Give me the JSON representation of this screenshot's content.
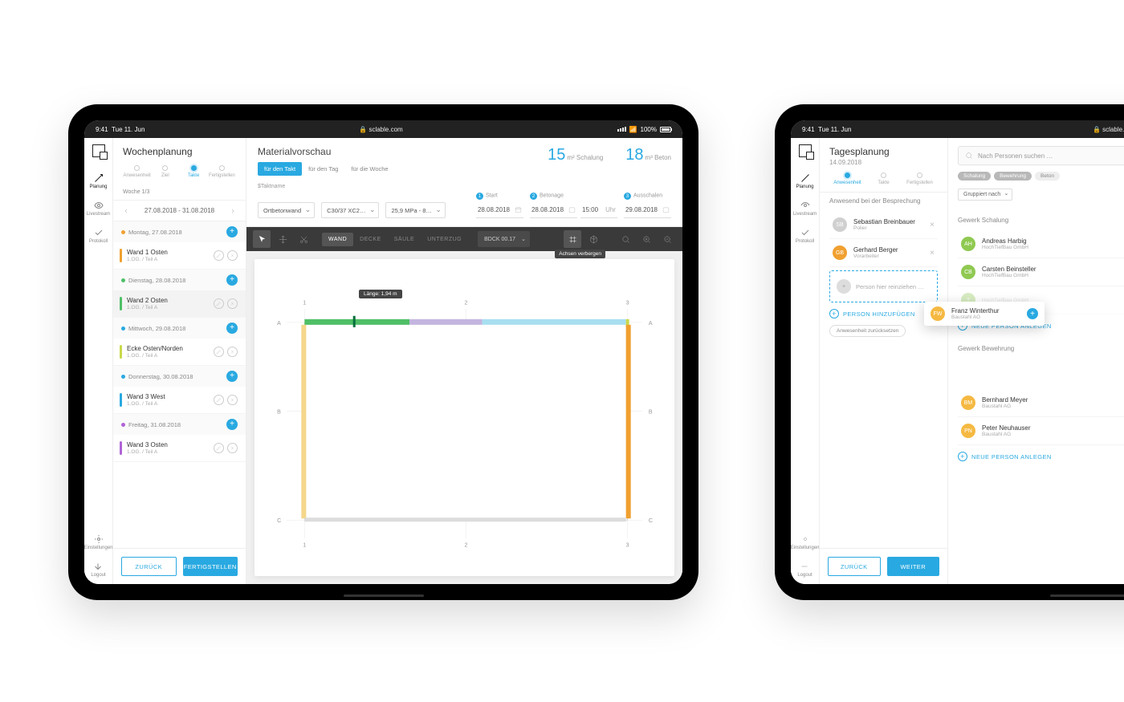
{
  "status": {
    "time": "9:41",
    "day": "Tue 11. Jun",
    "url": "sclable.com",
    "battery": "100%"
  },
  "nav": {
    "items": [
      {
        "id": "planung",
        "label": "Planung"
      },
      {
        "id": "livestream",
        "label": "Livestream"
      },
      {
        "id": "protokoll",
        "label": "Protokoll"
      }
    ],
    "settings": "Einstellungen",
    "logout": "Logout"
  },
  "t1": {
    "sidebar": {
      "title": "Wochenplanung",
      "steps": [
        {
          "label": "Anwesenheit"
        },
        {
          "label": "Ziel"
        },
        {
          "label": "Takte",
          "active": true
        },
        {
          "label": "Fertigstellen"
        }
      ],
      "week": "Woche 1/3",
      "range": "27.08.2018 - 31.08.2018",
      "days": [
        {
          "label": "Montag, 27.08.2018",
          "dot": "#f0a030",
          "tasks": [
            {
              "title": "Wand 1 Osten",
              "sub": "1.OG. / Teil A",
              "bar": "#f0a030"
            }
          ]
        },
        {
          "label": "Dienstag, 28.08.2018",
          "dot": "#4fbf67",
          "tasks": [
            {
              "title": "Wand 2 Osten",
              "sub": "1.OG. / Teil A",
              "bar": "#4fbf67",
              "sel": true
            }
          ]
        },
        {
          "label": "Mittwoch, 29.08.2018",
          "dot": "#29a9e1",
          "tasks": [
            {
              "title": "Ecke Osten/Norden",
              "sub": "1.OG. / Teil A",
              "bar": "#c9d94a"
            }
          ]
        },
        {
          "label": "Donnerstag, 30.08.2018",
          "dot": "#29a9e1",
          "tasks": [
            {
              "title": "Wand 3 West",
              "sub": "1.OG. / Teil A",
              "bar": "#29a9e1"
            }
          ]
        },
        {
          "label": "Freitag, 31.08.2018",
          "dot": "#b063d6",
          "tasks": [
            {
              "title": "Wand 3 Osten",
              "sub": "1.OG. / Teil A",
              "bar": "#b063d6"
            }
          ]
        }
      ],
      "back": "ZURÜCK",
      "finish": "FERTIGSTELLEN"
    },
    "main": {
      "title": "Materialvorschau",
      "scope": [
        {
          "label": "für den Takt",
          "active": true
        },
        {
          "label": "für den Tag"
        },
        {
          "label": "für die Woche"
        }
      ],
      "metrics": [
        {
          "big": "15",
          "unit": "m²",
          "label": "Schalung"
        },
        {
          "big": "18",
          "unit": "m³",
          "label": "Beton"
        }
      ],
      "cfg_label": "$Taktname",
      "selects": [
        "Ortbetonwand",
        "C30/37 XC2…",
        "25,9 MPa - 8…"
      ],
      "dates": [
        {
          "num": "1",
          "label": "Start",
          "value": "28.08.2018"
        },
        {
          "num": "2",
          "label": "Betonage",
          "value": "28.08.2018",
          "time": "15:00",
          "timeUnit": "Uhr"
        },
        {
          "num": "3",
          "label": "Ausschalen",
          "value": "29.08.2018"
        }
      ],
      "types": [
        {
          "l": "WAND",
          "a": true
        },
        {
          "l": "DECKE"
        },
        {
          "l": "SÄULE"
        },
        {
          "l": "UNTERZUG"
        }
      ],
      "blockSelect": "BDCK 00.17",
      "hoverTooltip": "Achsen verbergen",
      "lenTooltip": "Länge: 1,94 m"
    }
  },
  "t2": {
    "title": "Tagesplanung",
    "date": "14.09.2018",
    "searchPlaceholder": "Nach Personen suchen …",
    "steps": [
      {
        "label": "Anwesenheit",
        "active": true
      },
      {
        "label": "Takte"
      },
      {
        "label": "Fertigstellen"
      }
    ],
    "pills": [
      {
        "l": "Schalung",
        "a": true
      },
      {
        "l": "Bewehrung",
        "a": true
      },
      {
        "l": "Beton"
      }
    ],
    "groupBy": "Gruppiert nach",
    "left": {
      "heading": "Anwesend bei der Besprechung",
      "people": [
        {
          "name": "Sebastian Breinbauer",
          "sub": "Polier",
          "color": "#d0d0d0"
        },
        {
          "name": "Gerhard Berger",
          "sub": "Vorarbeiter",
          "color": "#f0a030"
        }
      ],
      "dropHint": "Person hier reinziehen …",
      "addPerson": "PERSON HINZUFÜGEN",
      "reset": "Anwesenheit zurücksetzen"
    },
    "right": {
      "sec1": "Gewerk Schalung",
      "schalung": [
        {
          "name": "Andreas Harbig",
          "sub": "HochTiefBau GmbH",
          "color": "#8fc951"
        },
        {
          "name": "Carsten Beinsteller",
          "sub": "HochTiefBau GmbH",
          "color": "#8fc951"
        },
        {
          "name": "",
          "sub": "HochTiefBau GmbH",
          "color": "#8fc951",
          "faded": true
        }
      ],
      "newPerson": "NEUE PERSON ANLEGEN",
      "sec2": "Gewerk Bewehrung",
      "bewehrung": [
        {
          "name": "Bernhard Meyer",
          "sub": "Baustahl AG",
          "color": "#f5b942"
        },
        {
          "name": "Peter Neuhauser",
          "sub": "Baustahl AG",
          "color": "#f5b942"
        }
      ]
    },
    "drag": {
      "name": "Franz Winterthur",
      "sub": "Baustahl AG"
    },
    "back": "ZURÜCK",
    "next": "WEITER"
  }
}
